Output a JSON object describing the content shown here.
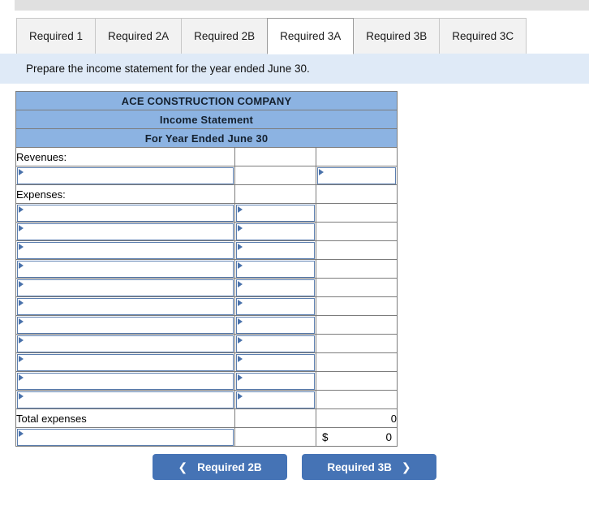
{
  "tabs": [
    {
      "label": "Required 1",
      "active": false
    },
    {
      "label": "Required 2A",
      "active": false
    },
    {
      "label": "Required 2B",
      "active": false
    },
    {
      "label": "Required 3A",
      "active": true
    },
    {
      "label": "Required 3B",
      "active": false
    },
    {
      "label": "Required 3C",
      "active": false
    }
  ],
  "banner": {
    "instruction": "Prepare the income statement for the year ended June 30."
  },
  "statement": {
    "header": {
      "company": "ACE CONSTRUCTION COMPANY",
      "title": "Income Statement",
      "period": "For Year Ended June 30"
    },
    "revenues_label": "Revenues:",
    "expenses_label": "Expenses:",
    "total_expenses_label": "Total expenses",
    "total_expenses_value": "0",
    "net_income_currency": "$",
    "net_income_value": "0",
    "revenue_input_rows": 1,
    "expense_input_rows": 11,
    "net_income_input_rows": 1
  },
  "nav": {
    "prev_label": "Required 2B",
    "prev_icon": "chevron-left-icon",
    "next_label": "Required 3B",
    "next_icon": "chevron-right-icon"
  },
  "colors": {
    "header_blue": "#8cb3e2",
    "banner_blue": "#dfeaf7",
    "button_blue": "#4573b5",
    "input_border": "#5c7fb0"
  }
}
